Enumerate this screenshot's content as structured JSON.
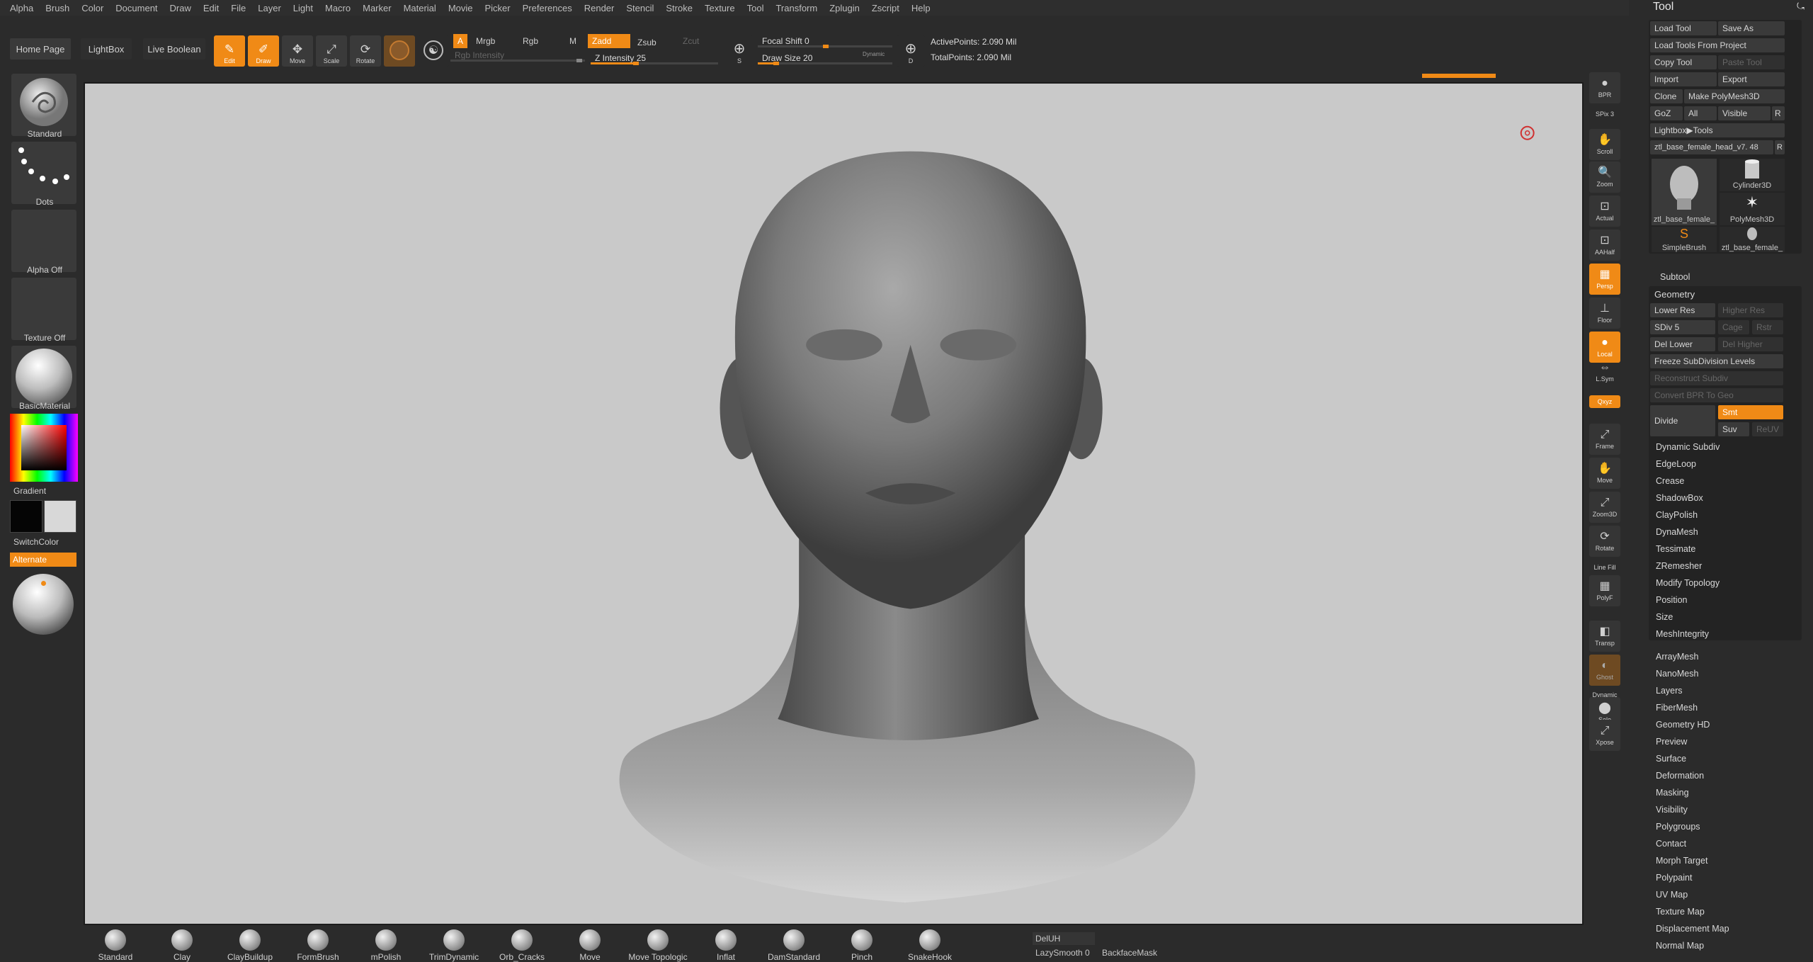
{
  "menubar": [
    "Alpha",
    "Brush",
    "Color",
    "Document",
    "Draw",
    "Edit",
    "File",
    "Layer",
    "Light",
    "Macro",
    "Marker",
    "Material",
    "Movie",
    "Picker",
    "Preferences",
    "Render",
    "Stencil",
    "Stroke",
    "Texture",
    "Tool",
    "Transform",
    "Zplugin",
    "Zscript",
    "Help"
  ],
  "shelf": {
    "home_page": "Home Page",
    "lightbox": "LightBox",
    "live_boolean": "Live Boolean",
    "edit": "Edit",
    "draw": "Draw",
    "move": "Move",
    "scale": "Scale",
    "rotate": "Rotate",
    "a": "A",
    "mrgb": "Mrgb",
    "rgb": "Rgb",
    "m": "M",
    "rgb_intensity": "Rgb Intensity",
    "zadd": "Zadd",
    "zsub": "Zsub",
    "zcut": "Zcut",
    "z_intensity": "Z Intensity 25",
    "focal_shift": "Focal Shift 0",
    "draw_size": "Draw Size 20",
    "dynamic": "Dynamic",
    "active_points": "ActivePoints: 2.090 Mil",
    "total_points": "TotalPoints: 2.090 Mil",
    "s_label": "S",
    "d_label": "D"
  },
  "left": {
    "brush_label": "Standard",
    "stroke_label": "Dots",
    "alpha_label": "Alpha Off",
    "texture_label": "Texture Off",
    "material_label": "BasicMaterial",
    "gradient_label": "Gradient",
    "switchcolor_label": "SwitchColor",
    "alternate_label": "Alternate"
  },
  "rightshelf": [
    {
      "label": "BPR"
    },
    {
      "label": "SPix 3"
    },
    {
      "label": "Scroll"
    },
    {
      "label": "Zoom"
    },
    {
      "label": "Actual"
    },
    {
      "label": "AAHalf"
    },
    {
      "label": "Persp"
    },
    {
      "label": "Floor"
    },
    {
      "label": "Local"
    },
    {
      "label": "L.Sym"
    },
    {
      "label": "Qxyz"
    },
    {
      "label": "Frame"
    },
    {
      "label": "Move"
    },
    {
      "label": "Zoom3D"
    },
    {
      "label": "Rotate"
    },
    {
      "label": "Line Fill"
    },
    {
      "label": "PolyF"
    },
    {
      "label": "Transp"
    },
    {
      "label": "Ghost"
    },
    {
      "label": "Dynamic"
    },
    {
      "label": "Solo"
    },
    {
      "label": "Xpose"
    }
  ],
  "toolpalette": {
    "title": "Tool",
    "load_tool": "Load Tool",
    "save_as": "Save As",
    "load_from_project": "Load Tools From Project",
    "copy_tool": "Copy Tool",
    "paste_tool": "Paste Tool",
    "import": "Import",
    "export": "Export",
    "clone": "Clone",
    "make_polymesh": "Make PolyMesh3D",
    "goz": "GoZ",
    "all": "All",
    "visible": "Visible",
    "r": "R",
    "lightbox_tools": "Lightbox▶Tools",
    "current_tool": "ztl_base_female_head_v7. 48",
    "thumbs": [
      "ztl_base_female_",
      "Cylinder3D",
      "PolyMesh3D",
      "SimpleBrush",
      "ztl_base_female_"
    ],
    "subtool": "Subtool",
    "geometry": "Geometry",
    "lower_res": "Lower Res",
    "higher_res": "Higher Res",
    "sdiv": "SDiv 5",
    "cage": "Cage",
    "rstr": "Rstr",
    "del_lower": "Del Lower",
    "del_higher": "Del Higher",
    "freeze": "Freeze SubDivision Levels",
    "reconstruct": "Reconstruct Subdiv",
    "convert_bpr": "Convert BPR To Geo",
    "divide": "Divide",
    "smt": "Smt",
    "suv": "Suv",
    "reuv": "ReUV",
    "geo_items": [
      "Dynamic Subdiv",
      "EdgeLoop",
      "Crease",
      "ShadowBox",
      "ClayPolish",
      "DynaMesh",
      "Tessimate",
      "ZRemesher",
      "Modify Topology",
      "Position",
      "Size",
      "MeshIntegrity"
    ],
    "sections": [
      "ArrayMesh",
      "NanoMesh",
      "Layers",
      "FiberMesh",
      "Geometry HD",
      "Preview",
      "Surface",
      "Deformation",
      "Masking",
      "Visibility",
      "Polygroups",
      "Contact",
      "Morph Target",
      "Polypaint",
      "UV Map",
      "Texture Map",
      "Displacement Map",
      "Normal Map"
    ]
  },
  "bottom": {
    "brushes": [
      "Standard",
      "Clay",
      "ClayBuildup",
      "FormBrush",
      "mPolish",
      "TrimDynamic",
      "Orb_Cracks",
      "Move",
      "Move Topologic",
      "Inflat",
      "DamStandard",
      "Pinch",
      "SnakeHook"
    ],
    "deluh": "DelUH",
    "lazysmooth": "LazySmooth 0",
    "backfacemask": "BackfaceMask"
  },
  "colors": {
    "accent": "#f08a16",
    "panel": "#2b2b2b",
    "canvas": "#c9c9c9"
  }
}
